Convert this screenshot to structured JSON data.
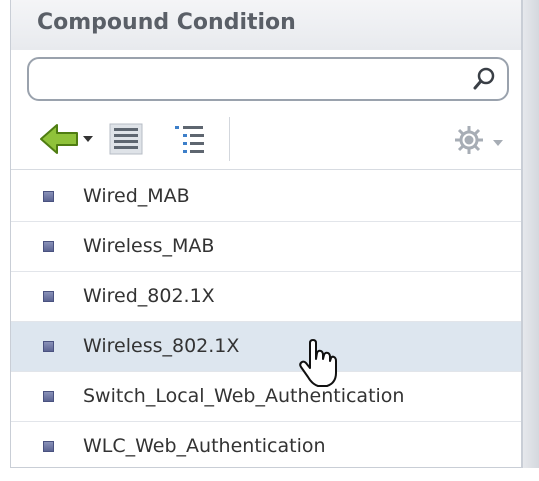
{
  "panel": {
    "title": "Compound Condition",
    "search": {
      "value": "",
      "placeholder": ""
    }
  },
  "toolbar": {
    "buttons": [
      {
        "icon": "arrow-left-dropdown-icon"
      },
      {
        "icon": "list-view-icon"
      },
      {
        "icon": "tree-view-icon"
      },
      {
        "icon": "gear-dropdown-icon"
      }
    ]
  },
  "list": {
    "items": [
      {
        "label": "Wired_MAB"
      },
      {
        "label": "Wireless_MAB"
      },
      {
        "label": "Wired_802.1X"
      },
      {
        "label": "Wireless_802.1X",
        "selected": true
      },
      {
        "label": "Switch_Local_Web_Authentication"
      },
      {
        "label": "WLC_Web_Authentication"
      }
    ]
  },
  "colors": {
    "selected_row": "#dde6ef",
    "title_text": "#5a5f67",
    "bullet": "#6b73a0"
  }
}
